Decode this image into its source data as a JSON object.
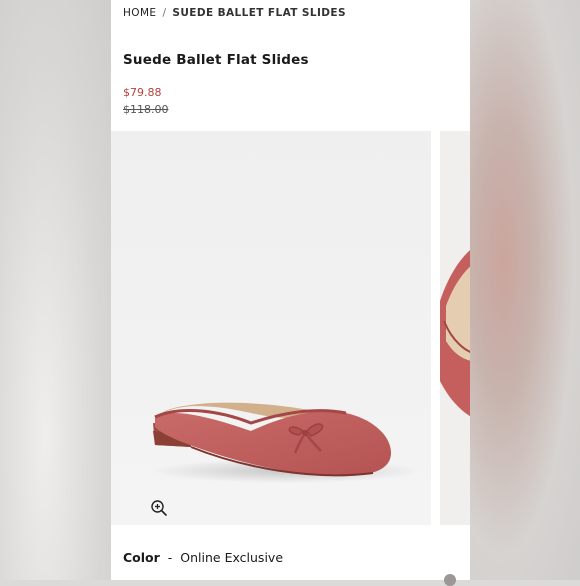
{
  "breadcrumb": {
    "home": "HOME",
    "separator": "/",
    "current": "SUEDE BALLET FLAT SLIDES"
  },
  "product": {
    "title": "Suede Ballet Flat Slides",
    "sale_price": "$79.88",
    "original_price": "$118.00"
  },
  "gallery": {
    "zoom_icon": "zoom-in-icon"
  },
  "color": {
    "label": "Color",
    "separator": "-",
    "value": "Online Exclusive"
  },
  "colors": {
    "sale": "#b3423f",
    "suede": "#bd5d5c"
  }
}
